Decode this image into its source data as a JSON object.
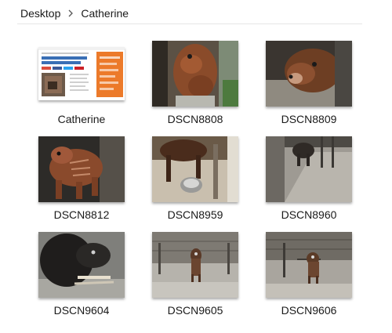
{
  "breadcrumb": {
    "items": [
      "Desktop",
      "Catherine"
    ],
    "separator_icon": "chevron-right-icon"
  },
  "files": [
    {
      "name": "Catherine",
      "kind": "document-thumbnail"
    },
    {
      "name": "DSCN8808",
      "kind": "photo"
    },
    {
      "name": "DSCN8809",
      "kind": "photo"
    },
    {
      "name": "DSCN8812",
      "kind": "photo"
    },
    {
      "name": "DSCN8959",
      "kind": "photo"
    },
    {
      "name": "DSCN8960",
      "kind": "photo"
    },
    {
      "name": "DSCN9604",
      "kind": "photo"
    },
    {
      "name": "DSCN9605",
      "kind": "photo"
    },
    {
      "name": "DSCN9606",
      "kind": "photo"
    }
  ]
}
